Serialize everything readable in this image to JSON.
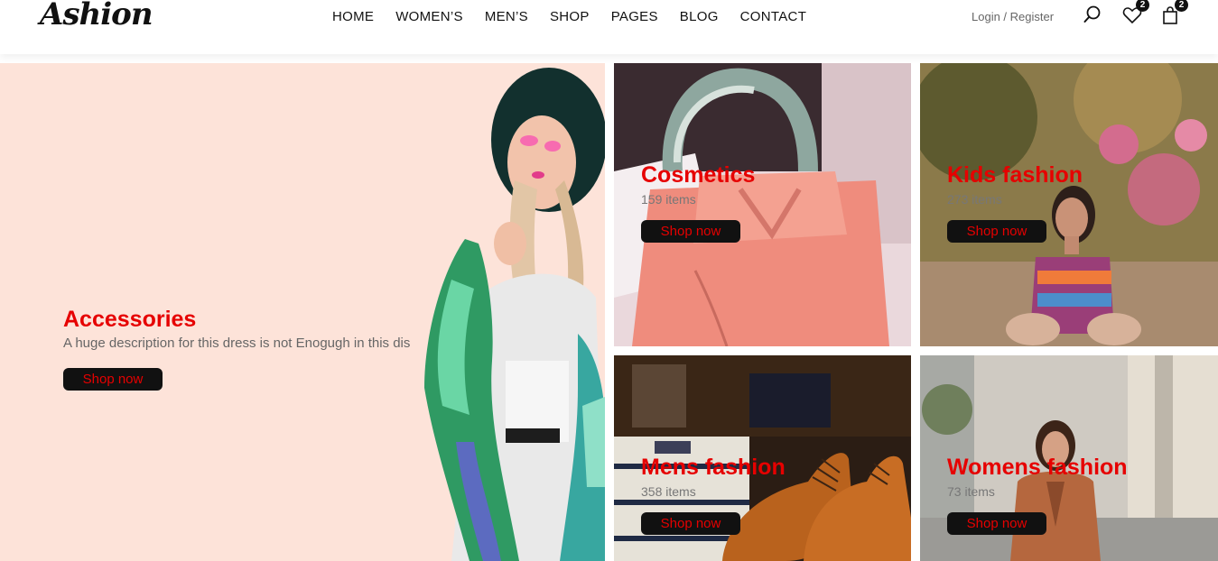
{
  "header": {
    "logo": "Ashion",
    "nav": [
      "HOME",
      "WOMEN’S",
      "MEN’S",
      "SHOP",
      "PAGES",
      "BLOG",
      "CONTACT"
    ],
    "login": "Login",
    "separator": " / ",
    "register": "Register",
    "wishlist_count": "2",
    "cart_count": "2",
    "icons": [
      "search-icon",
      "heart-icon",
      "bag-icon"
    ]
  },
  "categories": {
    "accessories": {
      "title": "Accessories",
      "description": "A huge description for this dress is not Enogugh in this dis",
      "button": "Shop now"
    },
    "cosmetics": {
      "title": "Cosmetics",
      "count": "159 items",
      "button": "Shop now"
    },
    "kids": {
      "title": "Kids fashion",
      "count": "273 items",
      "button": "Shop now"
    },
    "mens": {
      "title": "Mens fashion",
      "count": "358 items",
      "button": "Shop now"
    },
    "womens": {
      "title": "Womens fashion",
      "count": "73 items",
      "button": "Shop now"
    }
  },
  "colors": {
    "accent": "#e60000",
    "button_bg": "#111111",
    "hero_bg": "#fde3d9"
  }
}
